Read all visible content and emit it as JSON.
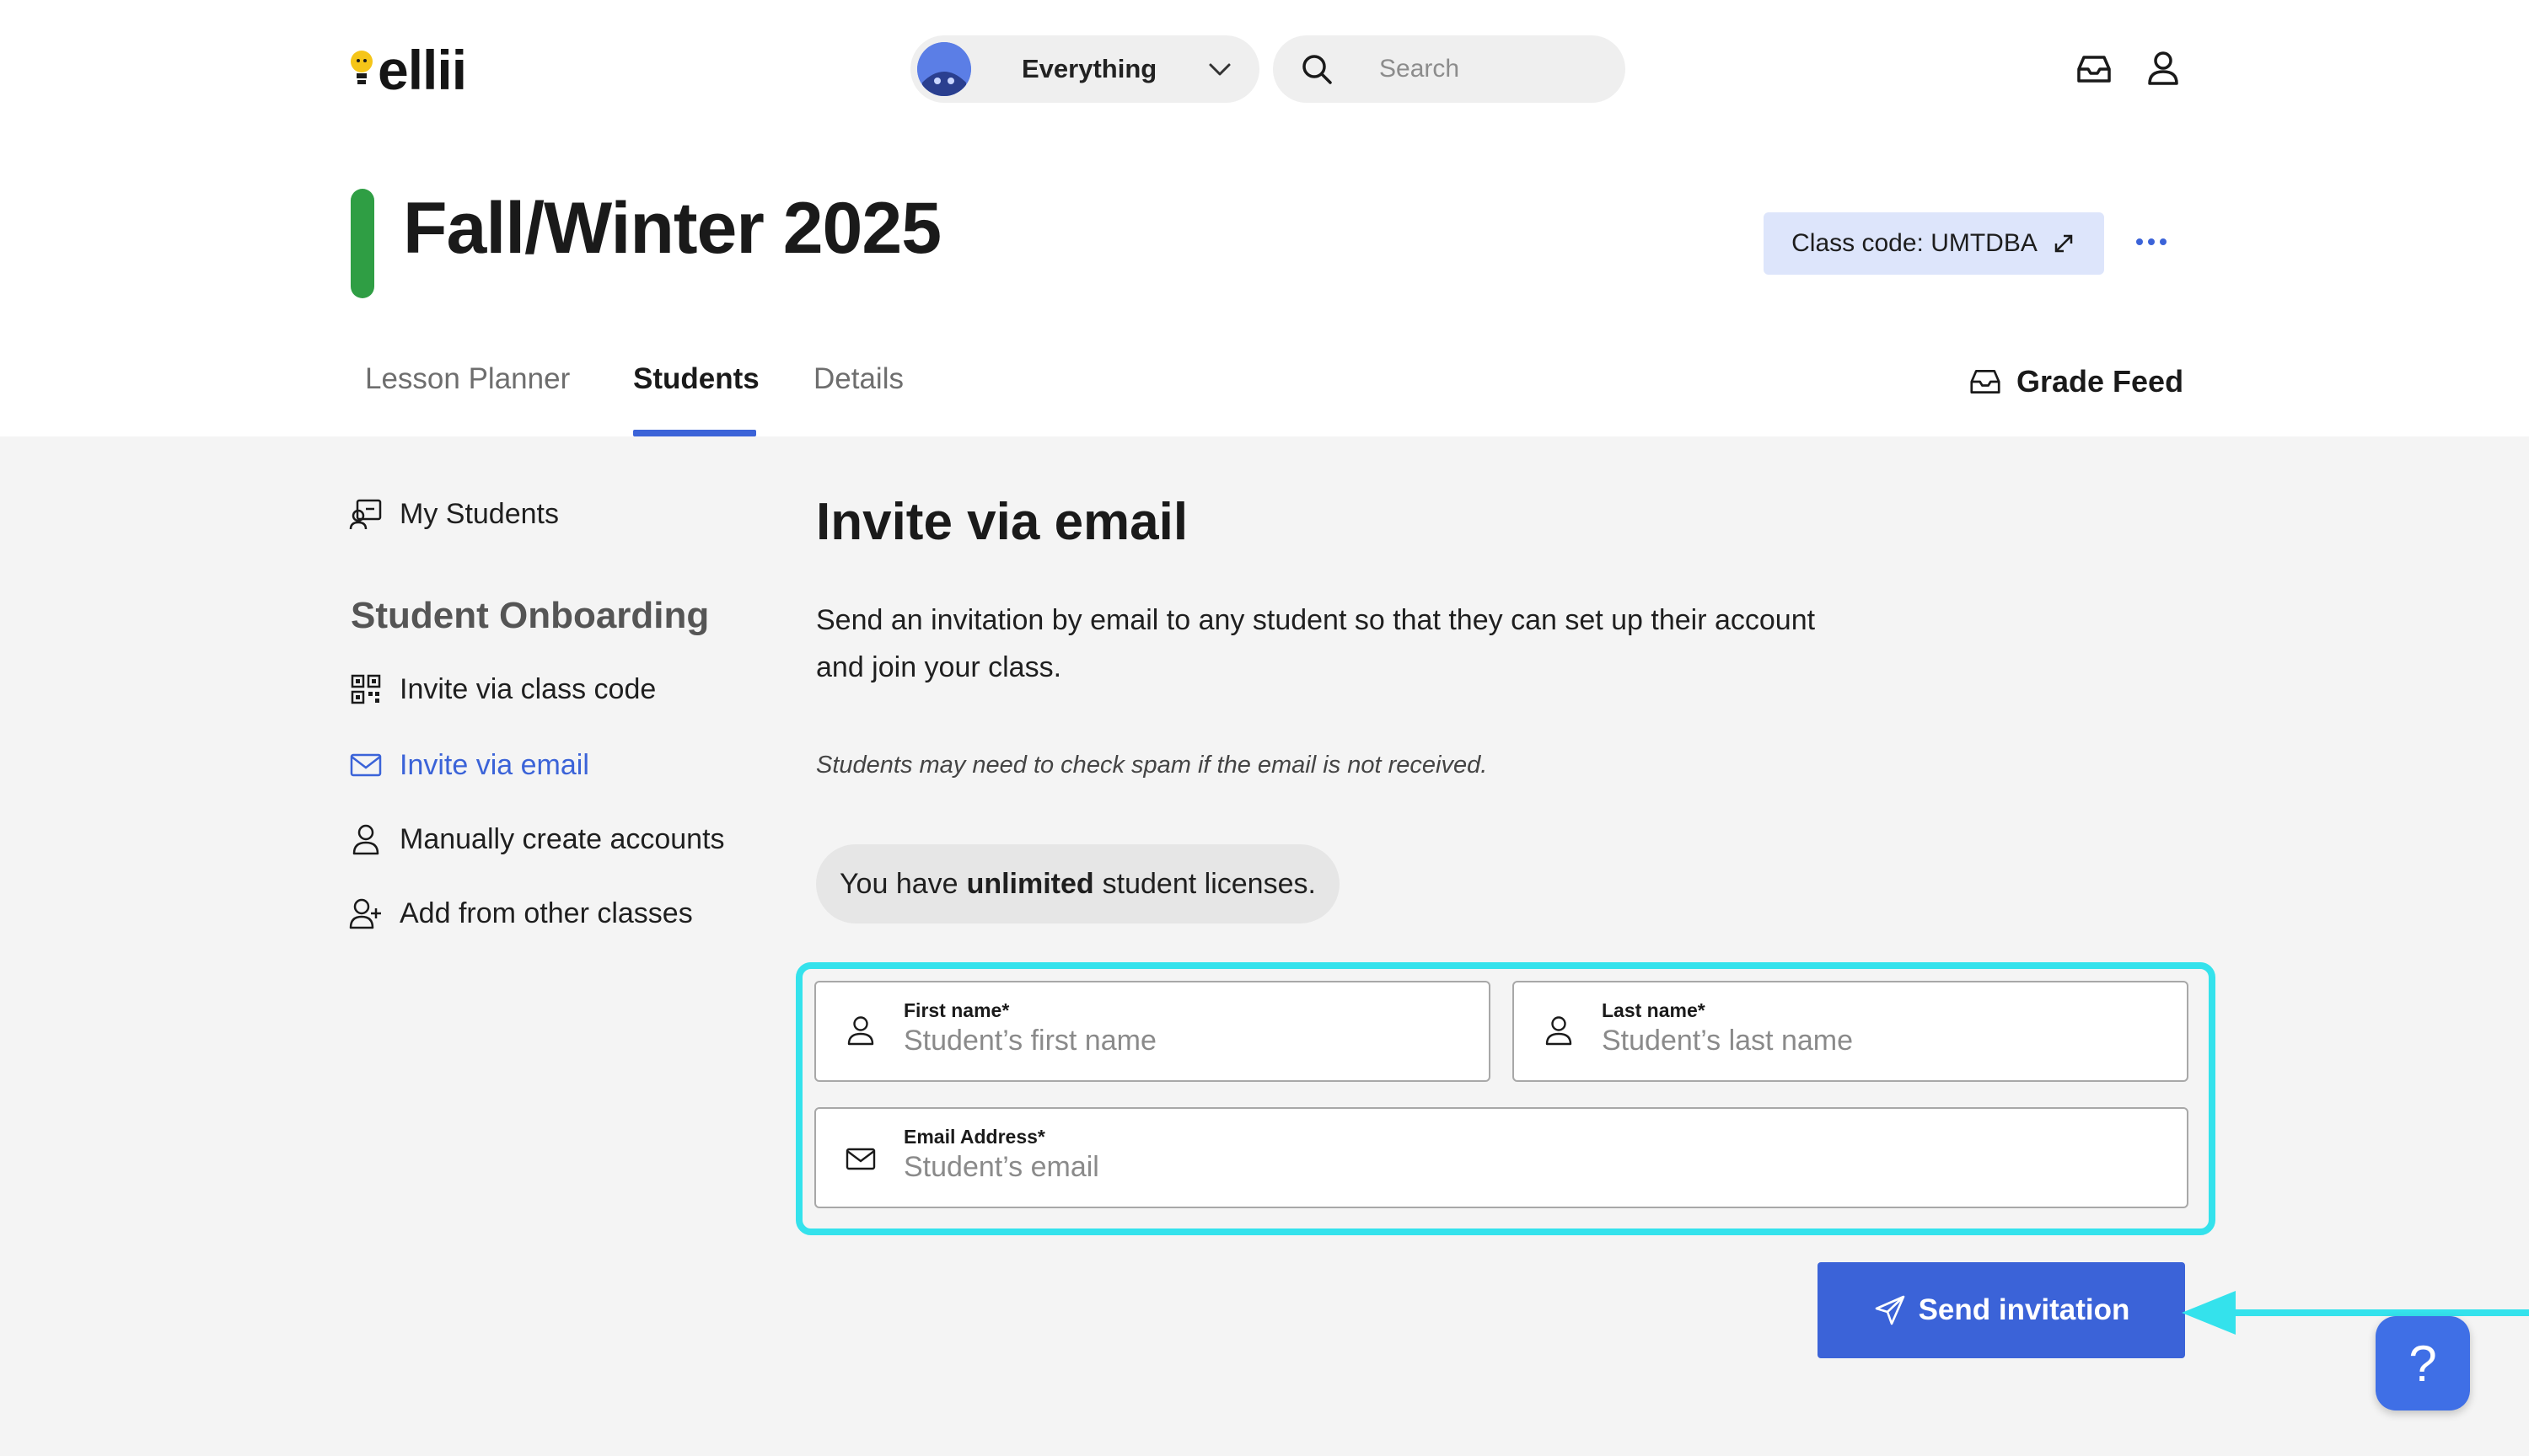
{
  "topbar": {
    "logo_text": "ellii",
    "scope_label": "Everything",
    "search_placeholder": "Search"
  },
  "header": {
    "class_title": "Fall/Winter 2025",
    "class_color": "#2f9e44",
    "class_code_label": "Class code: UMTDBA",
    "tabs": [
      {
        "label": "Lesson Planner",
        "active": false
      },
      {
        "label": "Students",
        "active": true
      },
      {
        "label": "Details",
        "active": false
      }
    ],
    "grade_feed_label": "Grade Feed"
  },
  "sidebar": {
    "my_students_label": "My Students",
    "section_title": "Student Onboarding",
    "items": [
      {
        "label": "Invite via class code",
        "icon": "qr-code-icon",
        "active": false
      },
      {
        "label": "Invite via email",
        "icon": "mail-icon",
        "active": true
      },
      {
        "label": "Manually create accounts",
        "icon": "user-icon",
        "active": false
      },
      {
        "label": "Add from other classes",
        "icon": "user-plus-icon",
        "active": false
      }
    ]
  },
  "main": {
    "title": "Invite via email",
    "description": "Send an invitation by email to any student so that they can set up their account and join your class.",
    "spam_note": "Students may need to check spam if the email is not received.",
    "license_prefix": "You have",
    "license_bold": "unlimited",
    "license_suffix": "student licenses.",
    "form": {
      "first_name_label": "First name*",
      "first_name_placeholder": "Student’s first name",
      "first_name_value": "",
      "last_name_label": "Last name*",
      "last_name_placeholder": "Student’s last name",
      "last_name_value": "",
      "email_label": "Email Address*",
      "email_placeholder": "Student’s email",
      "email_value": ""
    },
    "send_button_label": "Send invitation"
  },
  "help_button_label": "?",
  "colors": {
    "accent": "#3b63d8",
    "highlight": "#34e2ec"
  }
}
